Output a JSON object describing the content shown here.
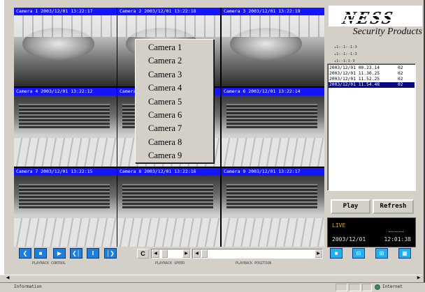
{
  "cameras": [
    {
      "title": "Camera 1 2003/12/01 13:22:17",
      "scene": "meeting"
    },
    {
      "title": "Camera 2 2003/12/01 13:22:18",
      "scene": "meeting"
    },
    {
      "title": "Camera 3 2003/12/01 13:22:19",
      "scene": "meeting"
    },
    {
      "title": "Camera 4 2003/12/01 13:22:12",
      "scene": "hall"
    },
    {
      "title": "Camera 5",
      "scene": "hall"
    },
    {
      "title": "Camera 6 2003/12/01 13:22:14",
      "scene": "hall"
    },
    {
      "title": "Camera 7 2003/12/01 13:22:15",
      "scene": "hall"
    },
    {
      "title": "Camera 8 2003/12/01 13:22:16",
      "scene": "hall"
    },
    {
      "title": "Camera 9 2003/12/01 13:22:17",
      "scene": "hall"
    }
  ],
  "context_menu": {
    "items": [
      "Camera 1",
      "Camera 2",
      "Camera 3",
      "Camera 4",
      "Camera 5",
      "Camera 6",
      "Camera 7",
      "Camera 8",
      "Camera 9"
    ]
  },
  "logo": {
    "brand": "NESS",
    "subtitle": "Security Products"
  },
  "status_list": [
    "1:-1:-1:3",
    "1:-1:-1:3",
    "1:-1:1-3"
  ],
  "event_list": {
    "rows": [
      {
        "ts": "2003/12/01 00.23.14",
        "ch": "02",
        "selected": false
      },
      {
        "ts": "2003/12/01 11.30.25",
        "ch": "02",
        "selected": false
      },
      {
        "ts": "2003/12/01 11.52.25",
        "ch": "02",
        "selected": false
      },
      {
        "ts": "2003/12/01 11.54.48",
        "ch": "02",
        "selected": true
      }
    ]
  },
  "buttons": {
    "play": "Play",
    "refresh": "Refresh",
    "c": "C"
  },
  "live": {
    "label": "LIVE",
    "date": "2003/12/01",
    "time": "12:01:38"
  },
  "controls": {
    "playback_buttons": [
      "❮",
      "■",
      "▶",
      "❮│",
      "‖",
      "│❯"
    ],
    "view_buttons": [
      "■",
      "⊟",
      "⊞",
      "▦"
    ],
    "labels": {
      "playback": "PLAYBACK CONTROL",
      "speed": "PLAYBACK SPEED",
      "position": "PLAYBACK POSITION"
    }
  },
  "statusbar": {
    "left": "Information",
    "zone": "Internet"
  },
  "colors": {
    "title_bar": "#1414ff",
    "ctl_blue": "#1e7fd8",
    "ctl_light": "#1fb0f0",
    "live_label": "#d8a82a"
  }
}
